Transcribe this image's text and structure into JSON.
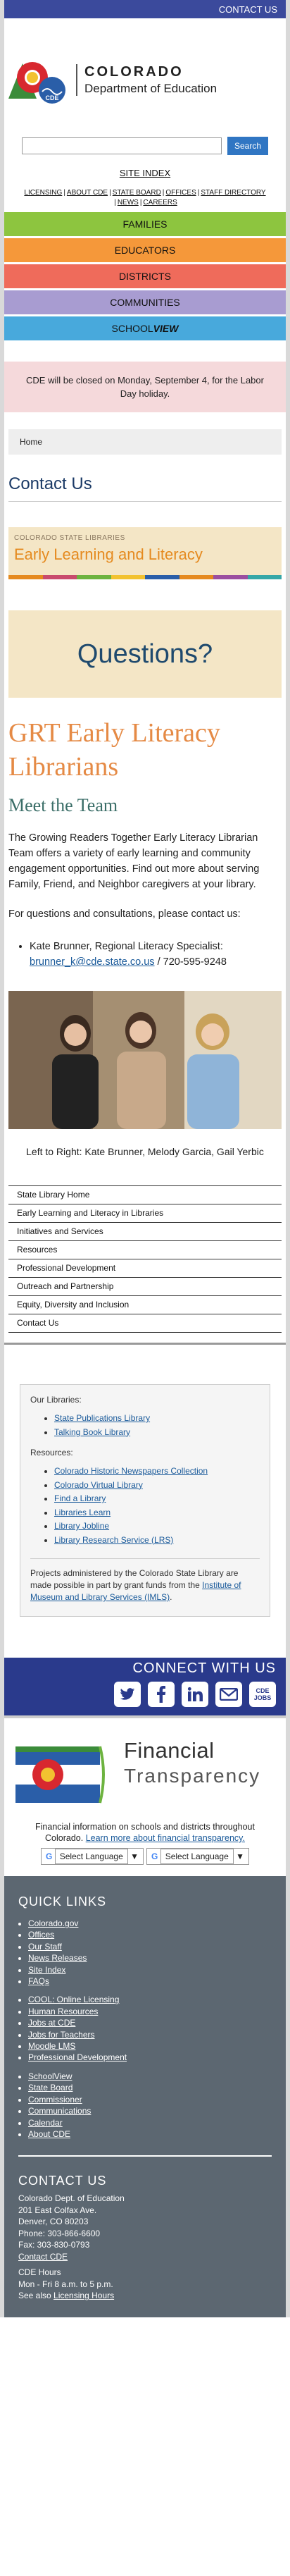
{
  "topbar": {
    "contact_label": "CONTACT US"
  },
  "logo": {
    "line1": "COLORADO",
    "line2": "Department of Education",
    "badge": "CDE"
  },
  "search": {
    "placeholder": "",
    "button_label": "Search"
  },
  "site_index": "SITE INDEX",
  "top_links": [
    "LICENSING",
    "ABOUT CDE",
    "STATE BOARD",
    "OFFICES",
    "STAFF DIRECTORY",
    "NEWS",
    "CAREERS"
  ],
  "nav": {
    "families": "FAMILIES",
    "educators": "EDUCATORS",
    "districts": "DISTRICTS",
    "communities": "COMMUNITIES",
    "school": "SCHOOL",
    "view": "view"
  },
  "alert": "CDE will be closed on Monday, September 4, for the Labor Day holiday.",
  "breadcrumb": "Home",
  "page_title": "Contact Us",
  "banner": {
    "top": "COLORADO STATE LIBRARIES",
    "title": "Early Learning and Literacy"
  },
  "questions": "Questions?",
  "grt_heading": "GRT Early Literacy Librarians",
  "meet_heading": "Meet the Team",
  "intro": "The Growing Readers Together Early Literacy Librarian Team offers a variety of early learning and community engagement opportunities. Find out more about serving Family, Friend, and Neighbor caregivers at your library.",
  "consult": "For questions and consultations, please contact us:",
  "contact": {
    "name": "Kate Brunner, Regional Literacy Specialist:",
    "email": "brunner_k@cde.state.co.us",
    "phone": " / 720-595-9248"
  },
  "caption": "Left to Right: Kate Brunner, Melody Garcia, Gail Yerbic",
  "sub_nav": [
    "State Library Home",
    "Early Learning and Literacy in Libraries",
    "Initiatives and Services",
    "Resources",
    "Professional Development",
    "Outreach and Partnership",
    "Equity, Diversity and Inclusion",
    "Contact Us"
  ],
  "our_libraries": {
    "label": "Our Libraries:",
    "items": [
      "State Publications Library",
      "Talking Book Library"
    ]
  },
  "resources": {
    "label": "Resources:",
    "items": [
      "Colorado Historic Newspapers Collection",
      "Colorado Virtual Library",
      "Find a Library",
      "Libraries Learn",
      "Library Jobline",
      "Library Research Service (LRS)"
    ]
  },
  "projects": {
    "text": "Projects administered by the Colorado State Library are made possible in part by grant funds from the ",
    "link": "Institute of Museum and Library Services (IMLS)",
    "end": "."
  },
  "connect": {
    "title": "CONNECT WITH US",
    "jobs": "CDE JOBS"
  },
  "financial": {
    "title": "Financial",
    "title2": "Transparency",
    "desc": "Financial information on schools and districts throughout Colorado. ",
    "link": "Learn more about financial transparency."
  },
  "language": {
    "label1": "Select Language",
    "label2": "Select Language"
  },
  "quick_links": {
    "title": "QUICK LINKS",
    "group1": [
      "Colorado.gov",
      "Offices",
      "Our Staff",
      "News Releases",
      "Site Index",
      "FAQs"
    ],
    "group2": [
      "COOL: Online Licensing",
      "Human Resources",
      "Jobs at CDE",
      "Jobs for Teachers",
      "Moodle LMS",
      "Professional Development"
    ],
    "group3": [
      "SchoolView",
      "State Board",
      "Commissioner",
      "Communications",
      "Calendar",
      "About CDE"
    ]
  },
  "footer_contact": {
    "title": "CONTACT US",
    "org": "Colorado Dept. of Education",
    "addr": "201 East Colfax Ave.",
    "city": "Denver, CO 80203",
    "phone": "Phone: 303-866-6600",
    "fax": "Fax: 303-830-0793",
    "link": "Contact CDE",
    "hours_title": "CDE Hours",
    "hours": "Mon - Fri 8 a.m. to 5 p.m.",
    "see_also": "See also ",
    "hours_link": "Licensing Hours"
  }
}
